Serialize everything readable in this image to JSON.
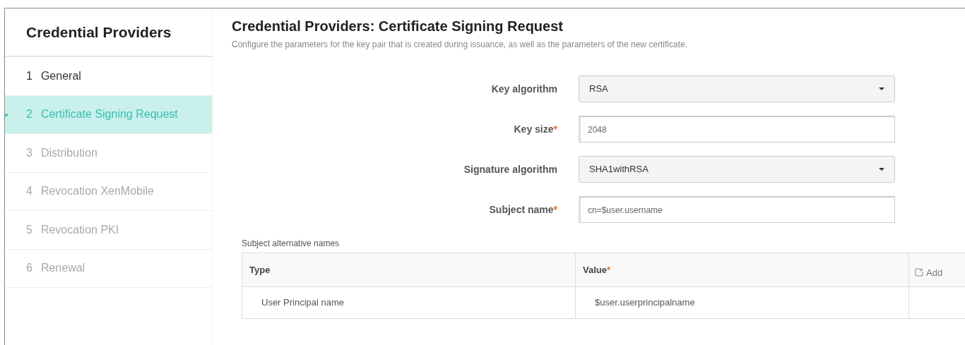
{
  "sidebar": {
    "title": "Credential Providers",
    "items": [
      {
        "number": "1",
        "label": "General",
        "selected": false,
        "disabled": false
      },
      {
        "number": "2",
        "label": "Certificate Signing Request",
        "selected": true,
        "disabled": false
      },
      {
        "number": "3",
        "label": "Distribution",
        "selected": false,
        "disabled": true
      },
      {
        "number": "4",
        "label": "Revocation XenMobile",
        "selected": false,
        "disabled": true
      },
      {
        "number": "5",
        "label": "Revocation PKI",
        "selected": false,
        "disabled": true
      },
      {
        "number": "6",
        "label": "Renewal",
        "selected": false,
        "disabled": true
      }
    ]
  },
  "page": {
    "title": "Credential Providers: Certificate Signing Request",
    "description": "Configure the parameters for the key pair that is created during issuance, as well as the parameters of the new certificate."
  },
  "fields": [
    {
      "kind": "select",
      "label": "Key algorithm",
      "value": "RSA"
    },
    {
      "kind": "text",
      "label": "Key size",
      "required_mark": "*",
      "value": "2048"
    },
    {
      "kind": "select",
      "label": "Signature algorithm",
      "value": "SHA1withRSA"
    },
    {
      "kind": "text",
      "label": "Subject name",
      "required_mark": "*",
      "value": "cn=$user.username"
    }
  ],
  "san_table": {
    "caption": "Subject alternative names",
    "columns": [
      {
        "label": "Type"
      },
      {
        "label": "Value",
        "required_mark": "*"
      }
    ],
    "add_button": "Add",
    "rows": [
      [
        "User Principal name",
        "$user.userprincipalname"
      ]
    ]
  }
}
